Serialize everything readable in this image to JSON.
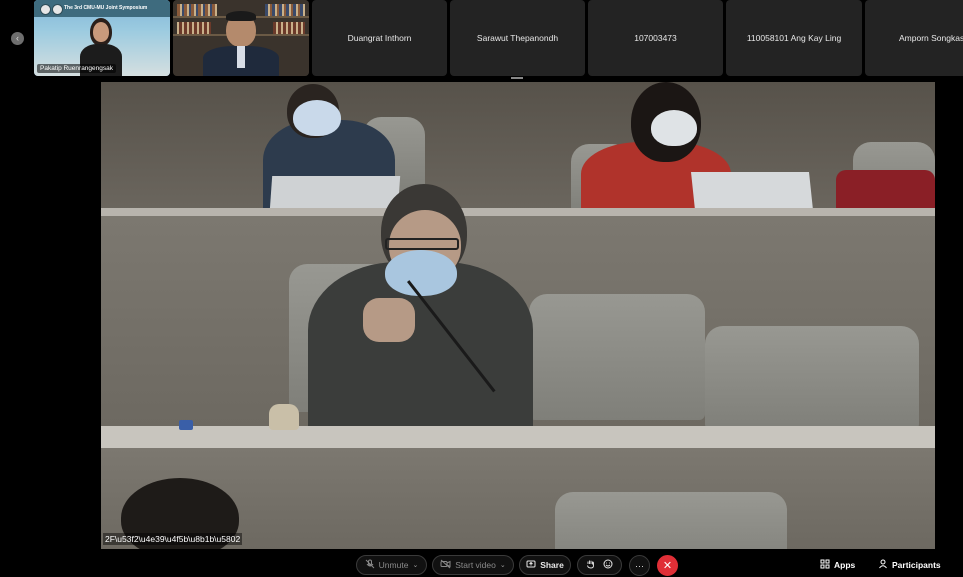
{
  "participants_strip": {
    "tiles": [
      {
        "name": "Pakatip Ruenrangengsak",
        "banner": "The 3rd CMU-MU Joint Symposium",
        "has_video": true
      },
      {
        "name": "",
        "has_video": true
      },
      {
        "name": "Duangrat Inthorn"
      },
      {
        "name": "Sarawut Thepanondh"
      },
      {
        "name": "107003473"
      },
      {
        "name": "110058101 Ang Kay Ling"
      },
      {
        "name": "Amporn Songkasi"
      }
    ]
  },
  "main_video": {
    "caption": "2F\\u53f2\\u4e39\\u4f5b\\u8b1b\\u5802"
  },
  "toolbar": {
    "unmute_label": "Unmute",
    "start_video_label": "Start video",
    "share_label": "Share",
    "more_label": "···",
    "leave_label": "✕",
    "apps_label": "Apps",
    "participants_label": "Participants"
  },
  "colors": {
    "leave": "#e02f37",
    "active_outline": "#4c8fd6",
    "tile_bg": "#232323"
  },
  "icons": [
    "chevron-left-icon",
    "mic-muted-icon",
    "video-off-icon",
    "share-icon",
    "raise-hand-icon",
    "reactions-icon",
    "more-icon",
    "leave-icon",
    "apps-icon",
    "participants-icon"
  ]
}
